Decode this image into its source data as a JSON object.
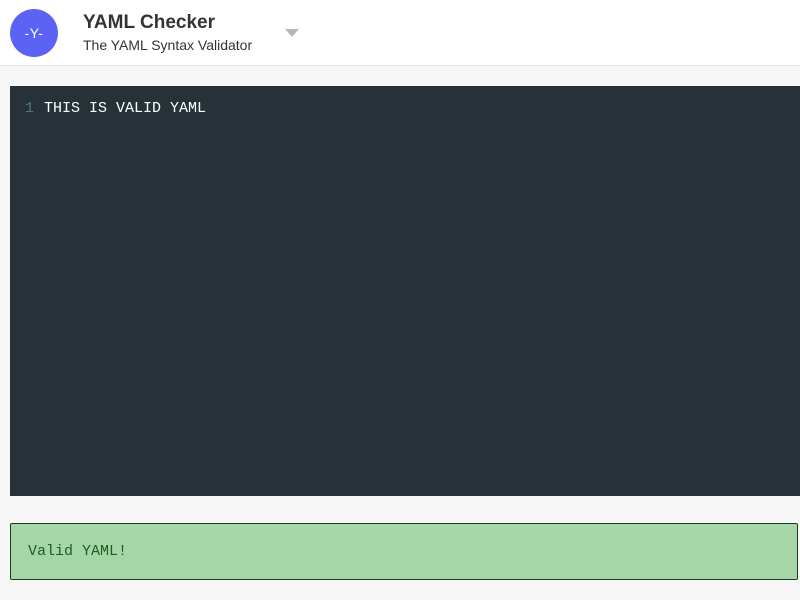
{
  "app": {
    "logo_text": "-Y-",
    "title": "YAML Checker",
    "subtitle": "The YAML Syntax Validator",
    "accent_color": "#5b63f5",
    "dropdown_icon": "caret-down-icon"
  },
  "editor": {
    "background_color": "#263238",
    "lines": [
      {
        "number": "1",
        "code": "THIS IS VALID YAML"
      }
    ]
  },
  "status": {
    "message": "Valid YAML!",
    "state": "valid",
    "background_color": "#a5d6a7"
  }
}
